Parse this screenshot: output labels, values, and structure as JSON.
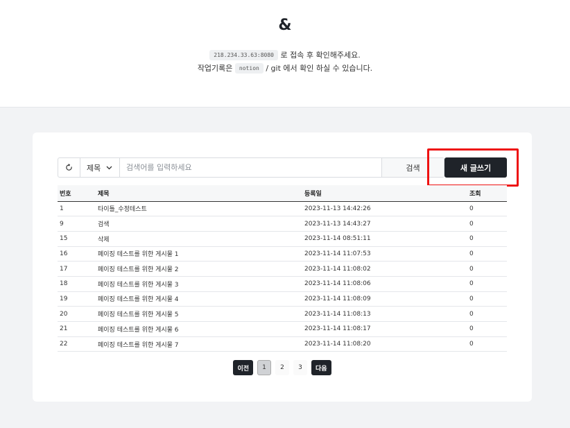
{
  "header": {
    "logo": "&",
    "line1": {
      "code": "218.234.33.63:8080",
      "text": "로 접속 후 확인해주세요."
    },
    "line2": {
      "prefix": "작업기록은",
      "code": "notion",
      "suffix": "/ git 에서 확인 하실 수 있습니다."
    }
  },
  "search": {
    "select_value": "제목",
    "placeholder": "검색어를 입력하세요",
    "button_label": "검색",
    "refresh_icon": "refresh-icon"
  },
  "new_post_label": "새 글쓰기",
  "table": {
    "headers": [
      "번호",
      "제목",
      "등록일",
      "조회"
    ],
    "rows": [
      [
        "1",
        "타이틀_수정테스트",
        "2023-11-13 14:42:26",
        "0"
      ],
      [
        "9",
        "검색",
        "2023-11-13 14:43:27",
        "0"
      ],
      [
        "15",
        "삭제",
        "2023-11-14 08:51:11",
        "0"
      ],
      [
        "16",
        "페이징 테스트를 위한 게시물 1",
        "2023-11-14 11:07:53",
        "0"
      ],
      [
        "17",
        "페이징 테스트를 위한 게시물 2",
        "2023-11-14 11:08:02",
        "0"
      ],
      [
        "18",
        "페이징 테스트를 위한 게시물 3",
        "2023-11-14 11:08:06",
        "0"
      ],
      [
        "19",
        "페이징 테스트를 위한 게시물 4",
        "2023-11-14 11:08:09",
        "0"
      ],
      [
        "20",
        "페이징 테스트를 위한 게시물 5",
        "2023-11-14 11:08:13",
        "0"
      ],
      [
        "21",
        "페이징 테스트를 위한 게시물 6",
        "2023-11-14 11:08:17",
        "0"
      ],
      [
        "22",
        "페이징 테스트를 위한 게시물 7",
        "2023-11-14 11:08:20",
        "0"
      ]
    ]
  },
  "pagination": {
    "prev": "이전",
    "pages": [
      "1",
      "2",
      "3"
    ],
    "current": "1",
    "next": "다음"
  },
  "colors": {
    "dark": "#1f2329",
    "highlight": "#ee1111",
    "page_bg": "#f2f3f5"
  }
}
